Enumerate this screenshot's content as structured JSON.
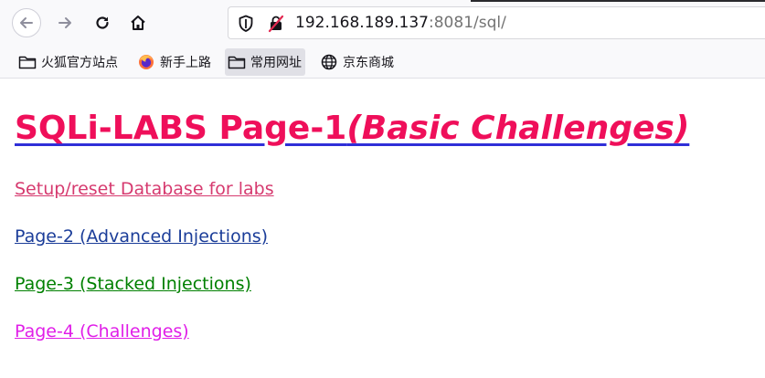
{
  "browser": {
    "url_host": "192.168.189.137",
    "url_rest": ":8081/sql/"
  },
  "bookmarks": [
    {
      "label": "火狐官方站点",
      "icon": "folder-icon"
    },
    {
      "label": "新手上路",
      "icon": "firefox-icon"
    },
    {
      "label": "常用网址",
      "icon": "folder-icon"
    },
    {
      "label": "京东商城",
      "icon": "globe-icon"
    }
  ],
  "page": {
    "title_main": "SQLi-LABS Page-1",
    "title_sub": "(Basic Challenges)",
    "links": {
      "setup": "Setup/reset Database for labs",
      "page2": "Page-2 (Advanced Injections)",
      "page3": "Page-3 (Stacked Injections)",
      "page4": "Page-4 (Challenges)"
    }
  },
  "colors": {
    "title": "#ef0f5a",
    "setup_link": "#d63a6f",
    "page2_link": "#1b3d99",
    "page3_link": "#008000",
    "page4_link": "#e01ee8"
  }
}
